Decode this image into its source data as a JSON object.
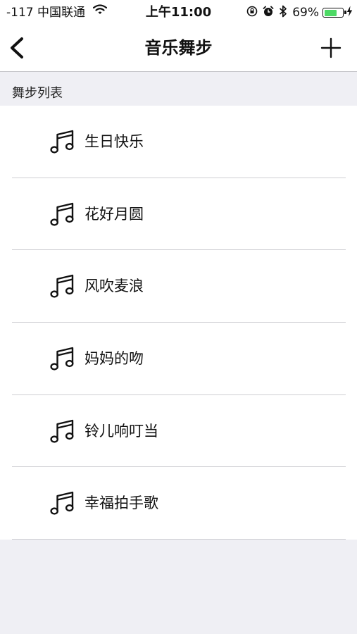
{
  "status_bar": {
    "carrier": "-117 中国联通",
    "time": "上午11:00",
    "battery": "69%",
    "battery_level": 0.69,
    "battery_color": "#4cd964",
    "icons": [
      "wifi-icon",
      "orientation-lock-icon",
      "alarm-icon",
      "bluetooth-icon",
      "battery-icon",
      "charging-icon"
    ]
  },
  "nav": {
    "title": "音乐舞步",
    "back_icon": "chevron-left-icon",
    "add_icon": "plus-icon"
  },
  "section": {
    "title": "舞步列表"
  },
  "songs": [
    {
      "title": "生日快乐",
      "icon": "music-note-icon"
    },
    {
      "title": "花好月圆",
      "icon": "music-note-icon"
    },
    {
      "title": "风吹麦浪",
      "icon": "music-note-icon"
    },
    {
      "title": "妈妈的吻",
      "icon": "music-note-icon"
    },
    {
      "title": "铃儿响叮当",
      "icon": "music-note-icon"
    },
    {
      "title": "幸福拍手歌",
      "icon": "music-note-icon"
    }
  ]
}
